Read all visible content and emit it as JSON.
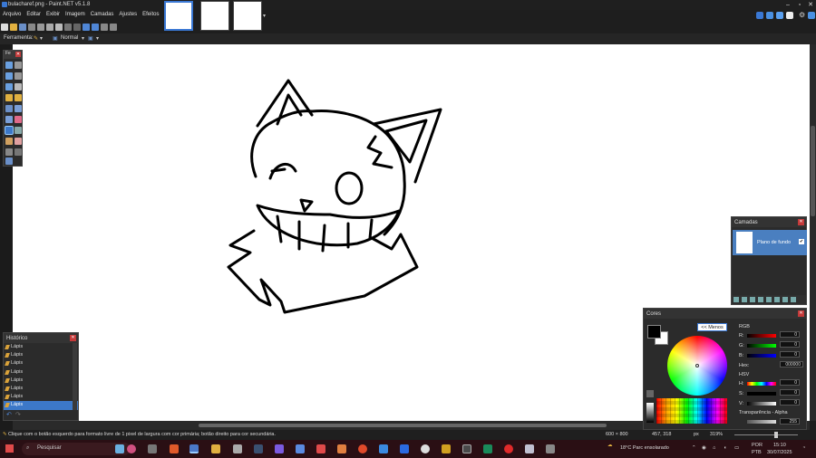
{
  "window": {
    "title": "bulacharef.png - Paint.NET v5.1.8"
  },
  "menu": [
    "Arquivo",
    "Editar",
    "Exibir",
    "Imagem",
    "Camadas",
    "Ajustes",
    "Efeitos"
  ],
  "tool_options": {
    "label": "Ferramenta:",
    "blend_mode": "Normal"
  },
  "tools_panel": {
    "title": "Fe"
  },
  "history": {
    "title": "Histórico",
    "items": [
      "Lápis",
      "Lápis",
      "Lápis",
      "Lápis",
      "Lápis",
      "Lápis",
      "Lápis",
      "Lápis"
    ],
    "selected_index": 7
  },
  "layers": {
    "title": "Camadas",
    "layer_name": "Plano de fundo",
    "checked": "✔"
  },
  "colors": {
    "title": "Cores",
    "less_button": "<< Menos",
    "rgb_label": "RGB",
    "r_label": "R:",
    "g_label": "G:",
    "b_label": "B:",
    "r_value": "0",
    "g_value": "0",
    "b_value": "0",
    "hex_label": "Hex:",
    "hex_value": "000000",
    "hsv_label": "HSV",
    "h_label": "H:",
    "s_label": "S:",
    "v_label": "V:",
    "h_value": "0",
    "s_value": "0",
    "v_value": "0",
    "alpha_label": "Transparência - Alpha",
    "alpha_value": "255",
    "primary": "#000000",
    "secondary": "#ffffff"
  },
  "status": {
    "hint": "Clique com o botão esquerdo para formato livre de 1 pixel de largura com cor primária; botão direito para cor secundária.",
    "image_size": "600 × 800",
    "cursor": "457, 318",
    "unit": "px",
    "zoom": "319%"
  },
  "taskbar": {
    "search_placeholder": "Pesquisar",
    "weather": "18°C  Parc ensolarado",
    "lang_top": "POR",
    "lang_bottom": "PTB",
    "time": "15:10",
    "date": "30/07/2025"
  }
}
